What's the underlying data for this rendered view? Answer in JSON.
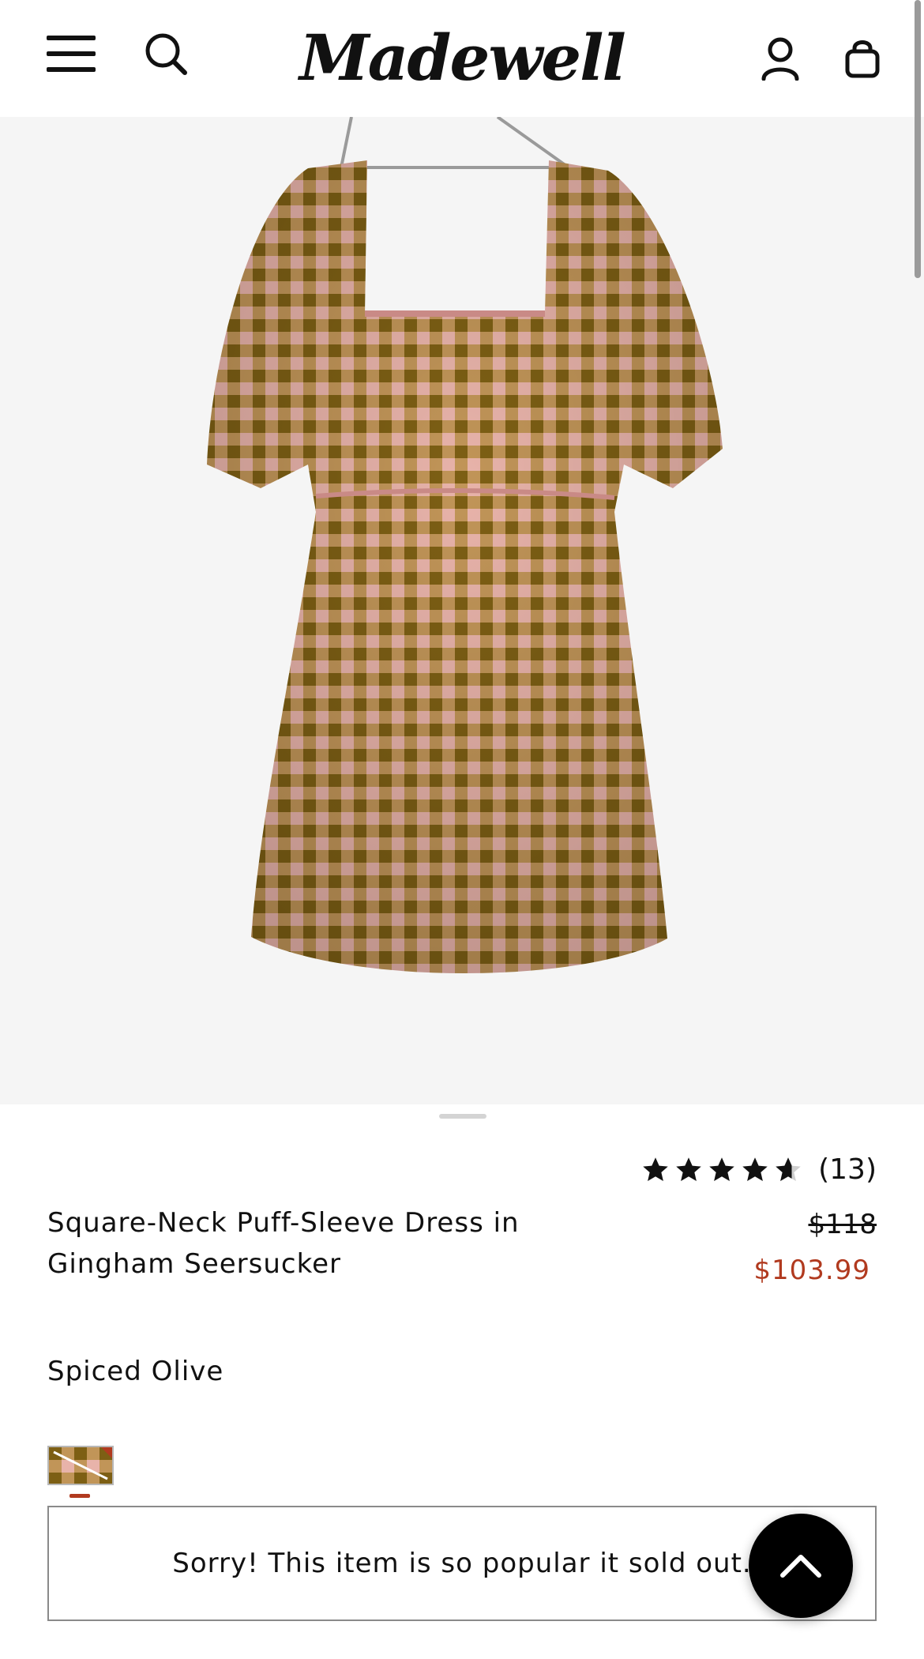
{
  "header": {
    "logo_text": "Madewell",
    "menu_icon": "hamburger-menu-icon",
    "search_icon": "search-icon",
    "account_icon": "user-account-icon",
    "bag_icon": "shopping-bag-icon"
  },
  "product": {
    "image_alt": "Square-Neck Puff-Sleeve Dress in Gingham Seersucker",
    "rating": 4.5,
    "review_count": "(13)",
    "title": "Square-Neck Puff-Sleeve Dress in Gingham Seersucker",
    "original_price": "$118",
    "sale_price": "$103.99",
    "color_name": "Spiced Olive",
    "sold_out_message": "Sorry! This item is so popular it sold out."
  },
  "colors": {
    "sale": "#b13a1f",
    "gingham_olive": "#8a6a1c",
    "gingham_pink": "#d9a19b"
  },
  "fab_icon": "chevron-up-icon"
}
